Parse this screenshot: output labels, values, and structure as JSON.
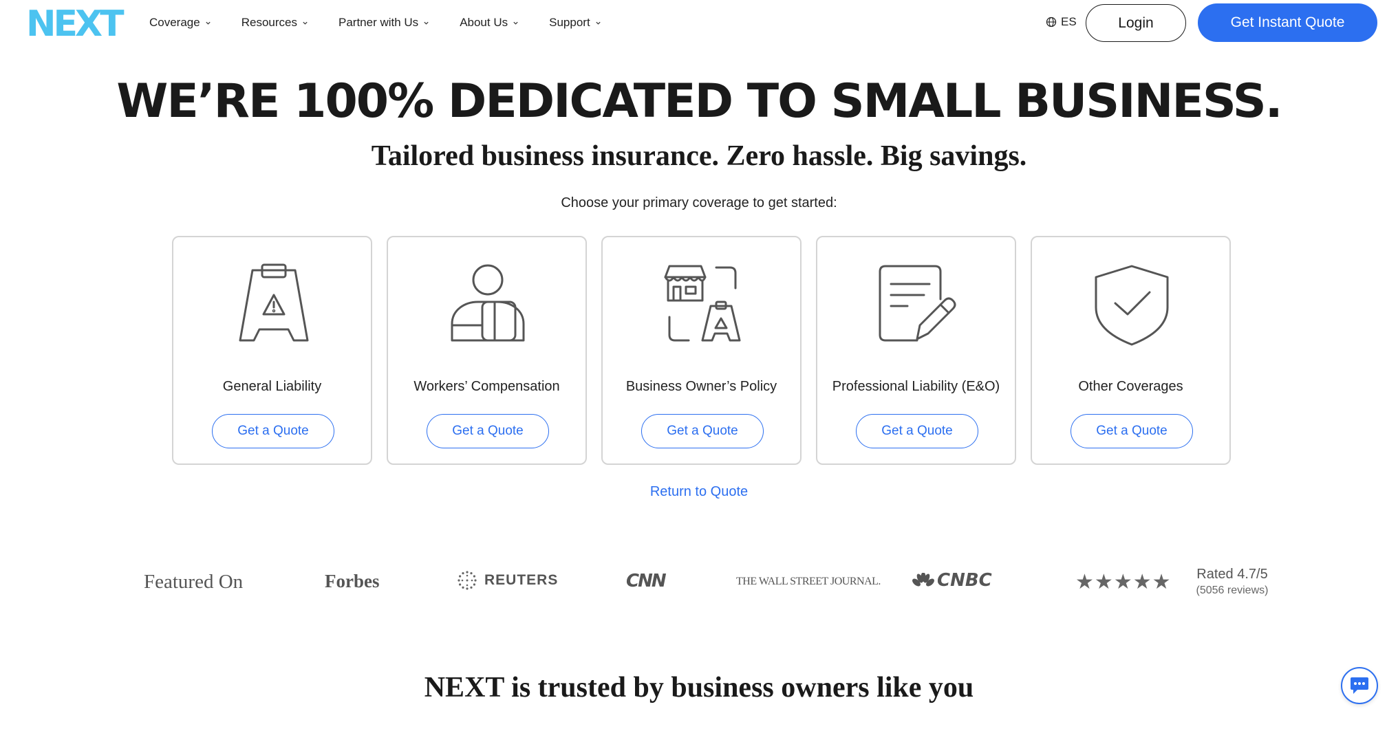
{
  "header": {
    "logo_text": "NEXT",
    "nav": [
      {
        "label": "Coverage"
      },
      {
        "label": "Resources"
      },
      {
        "label": "Partner with Us"
      },
      {
        "label": "About Us"
      },
      {
        "label": "Support"
      }
    ],
    "language": "ES",
    "login_label": "Login",
    "quote_label": "Get Instant Quote"
  },
  "hero": {
    "headline": "WE’RE 100% DEDICATED TO SMALL BUSINESS.",
    "subheadline": "Tailored business insurance. Zero hassle. Big savings.",
    "prompt": "Choose your primary coverage to get started:"
  },
  "coverages": [
    {
      "label": "General Liability",
      "button": "Get a Quote",
      "icon": "wet-floor-sign-icon"
    },
    {
      "label": "Workers’ Compensation",
      "button": "Get a Quote",
      "icon": "injured-worker-icon"
    },
    {
      "label": "Business Owner’s Policy",
      "button": "Get a Quote",
      "icon": "storefront-bundle-icon"
    },
    {
      "label": "Professional Liability (E&O)",
      "button": "Get a Quote",
      "icon": "document-pen-icon"
    },
    {
      "label": "Other Coverages",
      "button": "Get a Quote",
      "icon": "shield-check-icon"
    }
  ],
  "return_link": "Return to Quote",
  "featured": {
    "label": "Featured On",
    "outlets": [
      "Forbes",
      "REUTERS",
      "CNN",
      "THE WALL STREET JOURNAL.",
      "CNBC"
    ],
    "stars": [
      "★",
      "★",
      "★",
      "★",
      "★"
    ],
    "rating": "Rated 4.7/5",
    "reviews": "(5056 reviews)"
  },
  "trusted_heading": "NEXT is trusted by business owners like you",
  "colors": {
    "brand_blue": "#2c6ff0",
    "logo_cyan": "#4cc3f0",
    "text": "#1a1a1a"
  }
}
